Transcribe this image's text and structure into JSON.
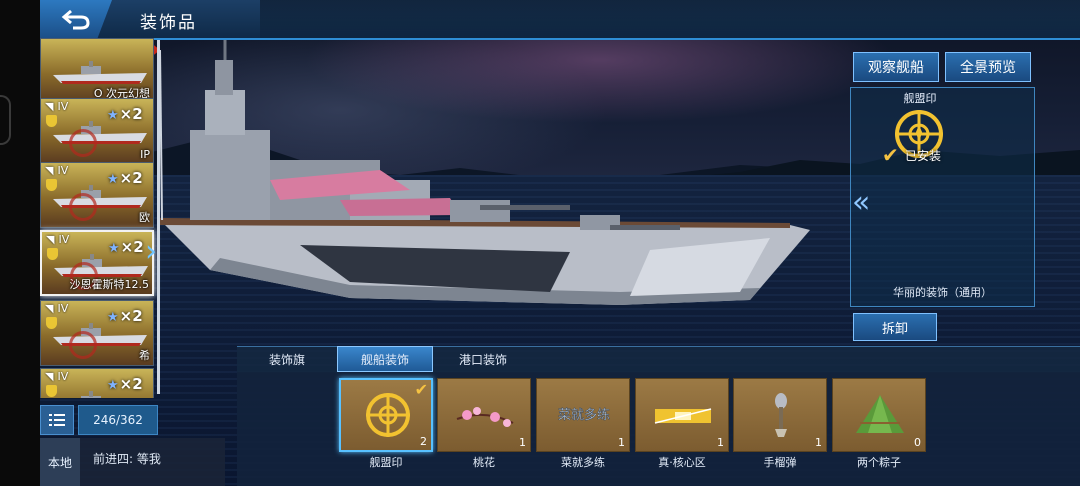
{
  "header": {
    "title": "装饰品",
    "back_icon": "back-arrow-icon"
  },
  "ship_list": {
    "items": [
      {
        "tier": "",
        "multiplier": "",
        "name": "O 次元幻想",
        "selected": false
      },
      {
        "tier": "IV",
        "multiplier": "×2",
        "name": "IP",
        "selected": false
      },
      {
        "tier": "IV",
        "multiplier": "×2",
        "name": "欧",
        "selected": false
      },
      {
        "tier": "IV",
        "multiplier": "×2",
        "name": "沙恩霍斯特12.5",
        "selected": true
      },
      {
        "tier": "IV",
        "multiplier": "×2",
        "name": "希",
        "selected": false
      },
      {
        "tier": "IV",
        "multiplier": "×2",
        "name": "",
        "selected": false
      }
    ],
    "count": "246/362"
  },
  "chat": {
    "channel": "本地",
    "message": "前进四: 等我"
  },
  "actions": {
    "observe": "观察舰船",
    "panorama": "全景预览",
    "unequip": "拆卸"
  },
  "detail": {
    "label": "舰盟印",
    "status": "已安装",
    "description": "华丽的装饰（通用）"
  },
  "tabs": [
    {
      "label": "装饰旗",
      "active": false
    },
    {
      "label": "舰船装饰",
      "active": true
    },
    {
      "label": "港口装饰",
      "active": false
    }
  ],
  "items": [
    {
      "label": "舰盟印",
      "count": "2",
      "selected": true,
      "installed": true
    },
    {
      "label": "桃花",
      "count": "1",
      "selected": false,
      "installed": false
    },
    {
      "label": "菜就多练",
      "count": "1",
      "selected": false,
      "installed": false
    },
    {
      "label": "真·核心区",
      "count": "1",
      "selected": false,
      "installed": false
    },
    {
      "label": "手榴弹",
      "count": "1",
      "selected": false,
      "installed": false
    },
    {
      "label": "两个粽子",
      "count": "0",
      "selected": false,
      "installed": false
    }
  ],
  "item_icon_texts": {
    "practice": "菜就多练"
  },
  "colors": {
    "accent": "#2f8ed6",
    "gold": "#f5c242",
    "item_bg": "#9c7a45"
  }
}
